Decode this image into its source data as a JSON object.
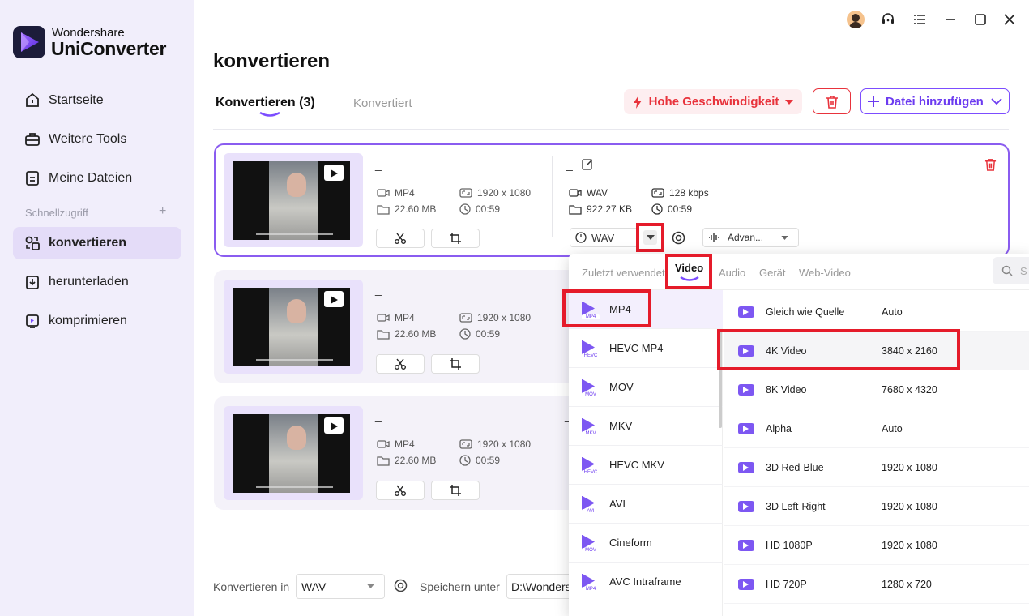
{
  "app": {
    "brand_top": "Wondershare",
    "brand_name": "UniConverter"
  },
  "sidebar": {
    "items": [
      {
        "label": "Startseite",
        "icon": "home-icon"
      },
      {
        "label": "Weitere Tools",
        "icon": "toolbox-icon"
      },
      {
        "label": "Meine Dateien",
        "icon": "file-icon"
      }
    ],
    "quick_access_label": "Schnellzugriff",
    "quick_access_add": "+",
    "quick_items": [
      {
        "label": "konvertieren",
        "icon": "convert-icon",
        "active": true
      },
      {
        "label": "herunterladen",
        "icon": "download-icon"
      },
      {
        "label": "komprimieren",
        "icon": "compress-icon"
      }
    ]
  },
  "window_controls": [
    "avatar",
    "headset-icon",
    "menu-icon",
    "minimize-icon",
    "maximize-icon",
    "close-icon"
  ],
  "page": {
    "title": "konvertieren",
    "tabs": [
      "Konvertieren (3)",
      "Konvertiert"
    ],
    "speed_button": "Hohe Geschwindigkeit",
    "add_button": "Datei hinzufügen"
  },
  "files": [
    {
      "name": "_",
      "source_format": "MP4",
      "source_resolution": "1920 x 1080",
      "source_size": "22.60 MB",
      "source_duration": "00:59",
      "target_name": "_",
      "target_format": "WAV",
      "target_bitrate": "128 kbps",
      "target_size": "922.27 KB",
      "target_duration": "00:59",
      "format_select": "WAV",
      "advanced": "Advan..."
    },
    {
      "name": "_",
      "source_format": "MP4",
      "source_resolution": "1920 x 1080",
      "source_size": "22.60 MB",
      "source_duration": "00:59"
    },
    {
      "name": "_",
      "source_format": "MP4",
      "source_resolution": "1920 x 1080",
      "source_size": "22.60 MB",
      "source_duration": "00:59",
      "target_name": "_"
    }
  ],
  "bottom": {
    "convert_in_label": "Konvertieren in",
    "convert_in_value": "WAV",
    "save_label": "Speichern unter",
    "save_path": "D:\\Wonders"
  },
  "dropdown": {
    "tabs": [
      "Zuletzt verwendet",
      "Video",
      "Audio",
      "Gerät",
      "Web-Video"
    ],
    "active_tab": "Video",
    "search_placeholder": "S",
    "formats": [
      {
        "label": "MP4",
        "badge": "MP4"
      },
      {
        "label": "HEVC MP4",
        "badge": "HEVC"
      },
      {
        "label": "MOV",
        "badge": "MOV"
      },
      {
        "label": "MKV",
        "badge": "MKV"
      },
      {
        "label": "HEVC MKV",
        "badge": "HEVC"
      },
      {
        "label": "AVI",
        "badge": "AVI"
      },
      {
        "label": "Cineform",
        "badge": "MOV"
      },
      {
        "label": "AVC Intraframe",
        "badge": "MP4"
      }
    ],
    "resolutions": [
      {
        "name": "Gleich wie Quelle",
        "value": "Auto"
      },
      {
        "name": "4K Video",
        "value": "3840 x 2160"
      },
      {
        "name": "8K Video",
        "value": "7680 x 4320"
      },
      {
        "name": "Alpha",
        "value": "Auto"
      },
      {
        "name": "3D Red-Blue",
        "value": "1920 x 1080"
      },
      {
        "name": "3D Left-Right",
        "value": "1920 x 1080"
      },
      {
        "name": "HD 1080P",
        "value": "1920 x 1080"
      },
      {
        "name": "HD 720P",
        "value": "1280 x 720"
      }
    ]
  },
  "colors": {
    "accent": "#7c4dff",
    "danger": "#e8333c",
    "highlight_box": "#e51b2a",
    "sidebar_bg": "#f1eefb"
  }
}
